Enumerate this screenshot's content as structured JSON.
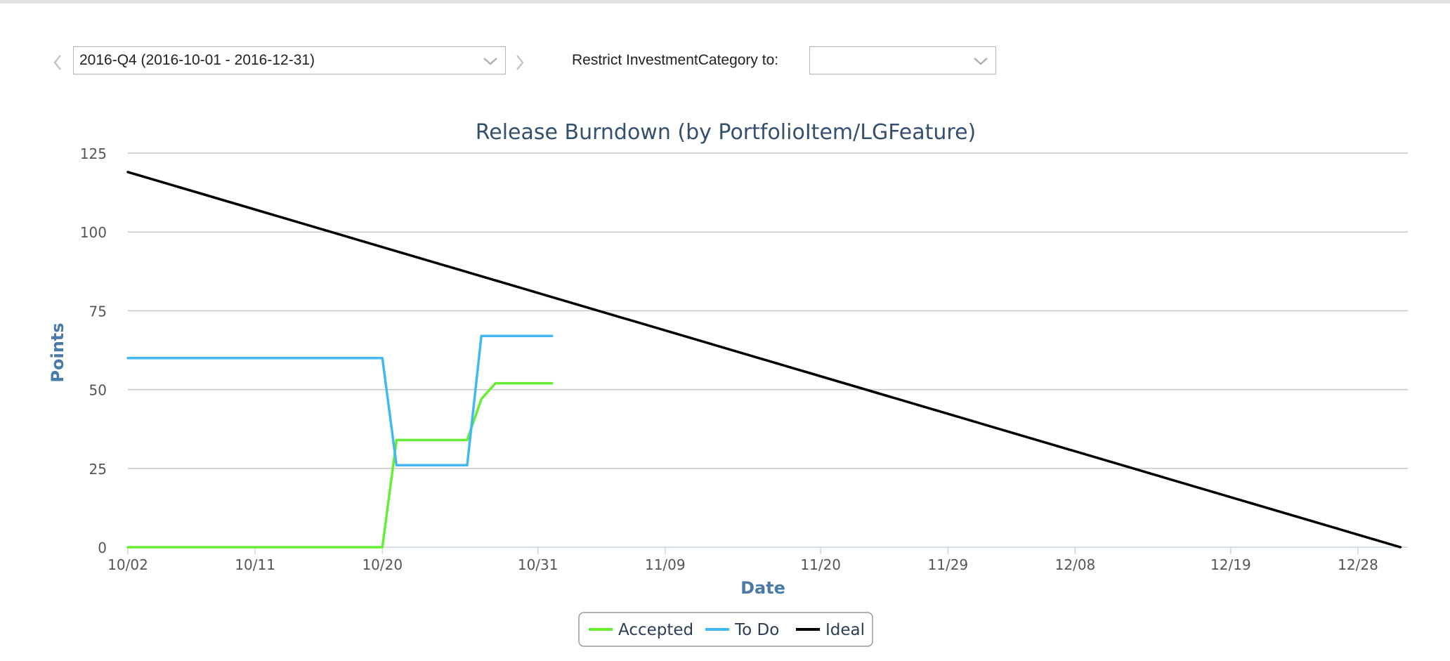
{
  "controls": {
    "release_value": "2016-Q4 (2016-10-01 - 2016-12-31)",
    "restrict_label": "Restrict InvestmentCategory to:",
    "category_value": ""
  },
  "colors": {
    "title": "#34506e",
    "axis_label": "#4a7aa8",
    "grid": "#c8c8c8",
    "tick_text": "#555555",
    "accepted": "#66ee33",
    "todo": "#44b8f0",
    "ideal": "#000000"
  },
  "chart_data": {
    "type": "line",
    "title": "Release Burndown (by PortfolioItem/LGFeature)",
    "xlabel": "Date",
    "ylabel": "Points",
    "ylim": [
      0,
      125
    ],
    "yticks": [
      0,
      25,
      50,
      75,
      100,
      125
    ],
    "xlim": [
      "2016-10-02",
      "2016-12-31"
    ],
    "xtick_labels": [
      {
        "date": "2016-10-02",
        "label": "10/02"
      },
      {
        "date": "2016-10-11",
        "label": "10/11"
      },
      {
        "date": "2016-10-20",
        "label": "10/20"
      },
      {
        "date": "2016-10-31",
        "label": "10/31"
      },
      {
        "date": "2016-11-09",
        "label": "11/09"
      },
      {
        "date": "2016-11-20",
        "label": "11/20"
      },
      {
        "date": "2016-11-29",
        "label": "11/29"
      },
      {
        "date": "2016-12-08",
        "label": "12/08"
      },
      {
        "date": "2016-12-19",
        "label": "12/19"
      },
      {
        "date": "2016-12-28",
        "label": "12/28"
      }
    ],
    "grid": true,
    "legend_position": "bottom-center",
    "series": [
      {
        "name": "Accepted",
        "color": "#66ee33",
        "points": [
          [
            "2016-10-02",
            0
          ],
          [
            "2016-10-20",
            0
          ],
          [
            "2016-10-21",
            34
          ],
          [
            "2016-10-25",
            34
          ],
          [
            "2016-10-26",
            34
          ],
          [
            "2016-10-27",
            47
          ],
          [
            "2016-10-28",
            52
          ],
          [
            "2016-11-01",
            52
          ]
        ]
      },
      {
        "name": "To Do",
        "color": "#44b8f0",
        "points": [
          [
            "2016-10-02",
            60
          ],
          [
            "2016-10-20",
            60
          ],
          [
            "2016-10-21",
            26
          ],
          [
            "2016-10-25",
            26
          ],
          [
            "2016-10-26",
            26
          ],
          [
            "2016-10-27",
            67
          ],
          [
            "2016-11-01",
            67
          ]
        ]
      },
      {
        "name": "Ideal",
        "color": "#000000",
        "points": [
          [
            "2016-10-02",
            119
          ],
          [
            "2016-12-31",
            0
          ]
        ]
      }
    ]
  }
}
